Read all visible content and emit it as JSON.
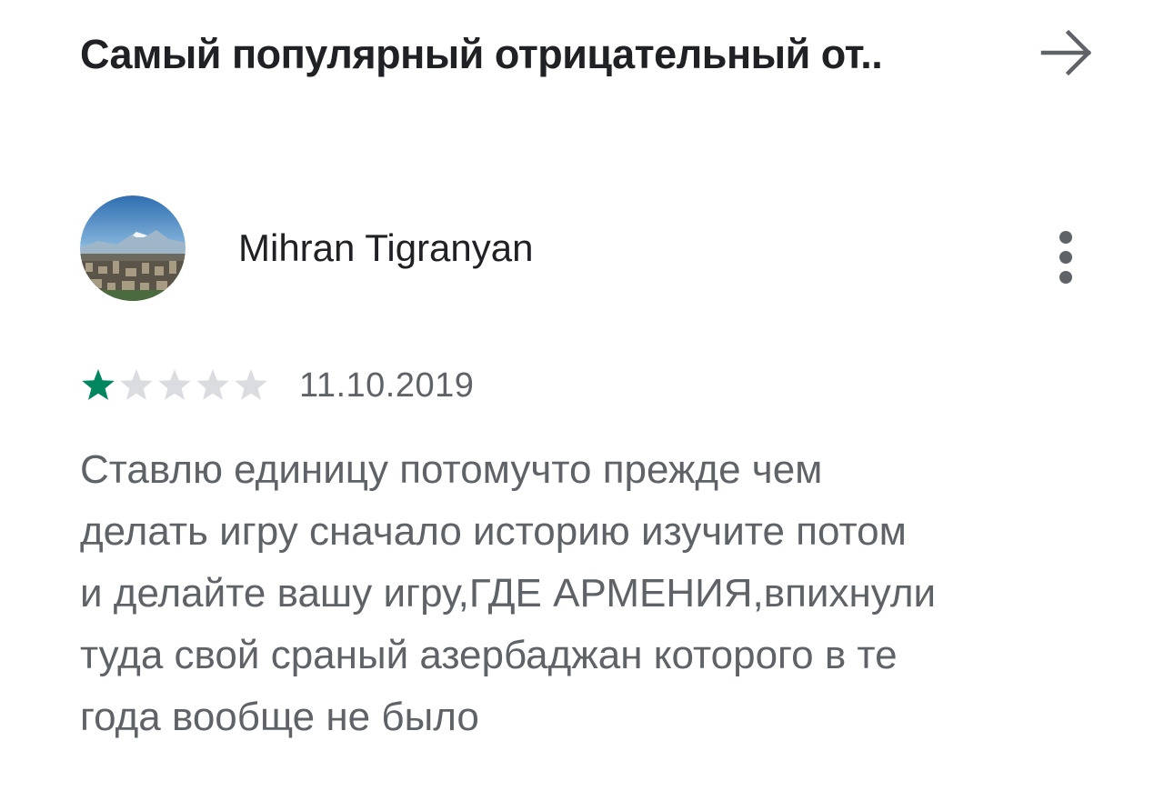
{
  "header": {
    "title": "Самый популярный отрицательный от..",
    "arrow_icon": "arrow-right-icon"
  },
  "review": {
    "author": "Mihran Tigranyan",
    "avatar_icon": "user-avatar-landscape",
    "menu_icon": "more-vert-icon",
    "rating": 1,
    "max_rating": 5,
    "date": "11.10.2019",
    "text": "Ставлю единицу потомучто прежде чем\nделать игру сначало историю изучите потом\nи делайте вашу игру,ГДЕ АРМЕНИЯ,впихнули\nтуда свой сраный азербаджан которого в те\nгода вообще не было"
  },
  "colors": {
    "title": "#202124",
    "secondary_text": "#5f6368",
    "star_filled": "#01875f",
    "star_empty": "#dadce0",
    "icon": "#5f6368"
  }
}
